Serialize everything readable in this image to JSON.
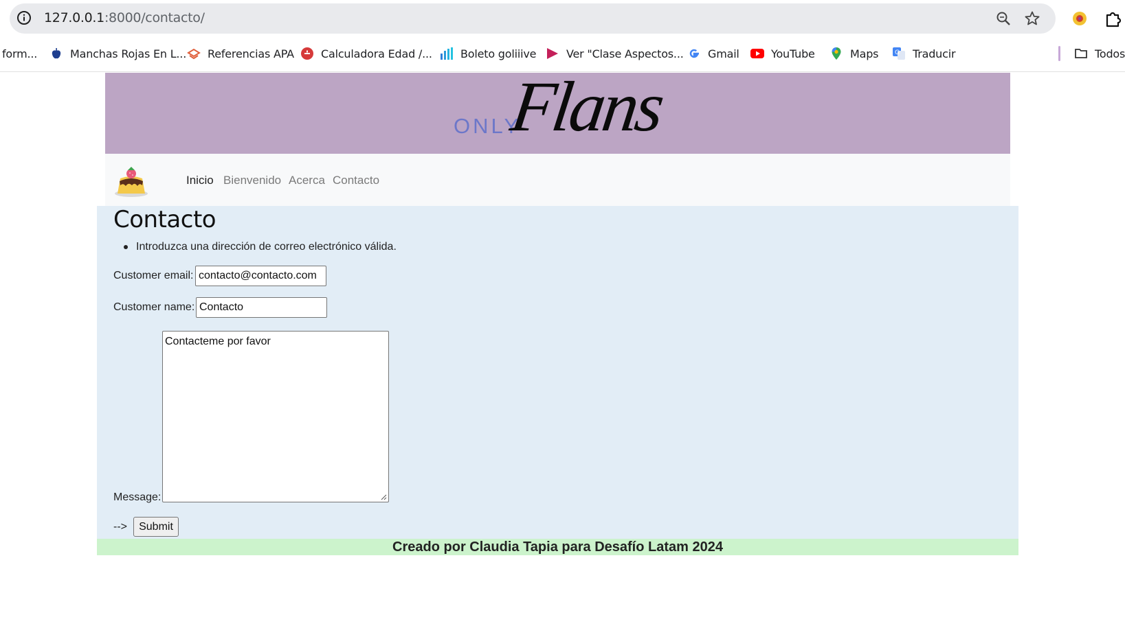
{
  "browser": {
    "url_host": "127.0.0.1",
    "url_rest": ":8000/contacto/",
    "bookmarks": [
      {
        "label": "form...",
        "icon": "none"
      },
      {
        "label": "Manchas Rojas En L...",
        "icon": "apple-icon"
      },
      {
        "label": "Referencias APA",
        "icon": "apa-icon"
      },
      {
        "label": "Calculadora Edad /...",
        "icon": "calculator-icon"
      },
      {
        "label": "Boleto goliiive",
        "icon": "bars-icon"
      },
      {
        "label": "Ver \"Clase Aspectos...",
        "icon": "play-icon"
      },
      {
        "label": "Gmail",
        "icon": "google-icon"
      },
      {
        "label": "YouTube",
        "icon": "youtube-icon"
      },
      {
        "label": "Maps",
        "icon": "maps-pin-icon"
      },
      {
        "label": "Traducir",
        "icon": "translate-icon"
      },
      {
        "label": "Todos",
        "icon": "folder-icon"
      }
    ]
  },
  "header": {
    "logo_small": "ONLY",
    "logo_script": "Flans"
  },
  "nav": {
    "links": [
      "Inicio",
      "Bienvenido",
      "Acerca",
      "Contacto"
    ],
    "active": "Inicio"
  },
  "main": {
    "title": "Contacto",
    "error": "Introduzca una dirección de correo electrónico válida.",
    "email_label": "Customer email:",
    "email_value": "contacto@contacto.com",
    "name_label": "Customer name:",
    "name_value": "Contacto",
    "message_label": "Message:",
    "message_value": "Contacteme por favor",
    "arrow_text": "-->",
    "submit_label": "Submit"
  },
  "footer": {
    "text": "Creado por Claudia Tapia para Desafío Latam 2024"
  },
  "colors": {
    "header_bg": "#bca5c4",
    "main_bg": "#e2edf6",
    "footer_bg": "#ccf3cc",
    "logo_accent": "#6c77c9"
  }
}
